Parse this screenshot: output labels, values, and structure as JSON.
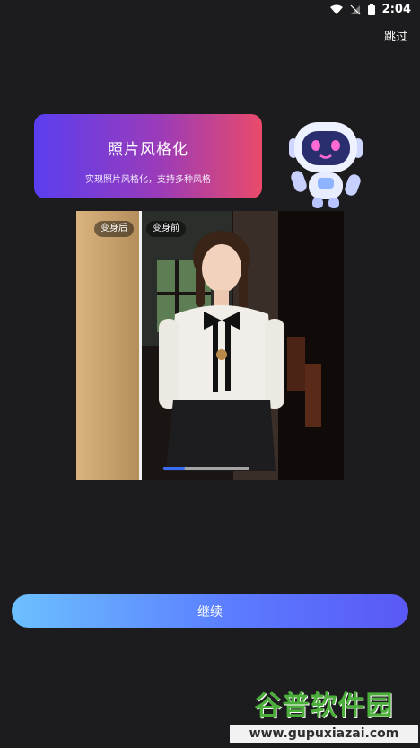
{
  "status_bar": {
    "time": "2:04"
  },
  "header": {
    "skip_label": "跳过"
  },
  "feature": {
    "title": "照片风格化",
    "subtitle": "实现照片风格化，支持多种风格"
  },
  "preview": {
    "after_label": "变身后",
    "before_label": "变身前",
    "progress": 0.25
  },
  "actions": {
    "continue_label": "继续"
  },
  "watermark": {
    "title": "谷普软件园",
    "url": "www.gupuxiazai.com"
  },
  "colors": {
    "background": "#1c1c1e",
    "card_gradient_start": "#5a3ef0",
    "card_gradient_end": "#e94a6a",
    "button_gradient_start": "#6cc0ff",
    "button_gradient_end": "#5a58f5",
    "progress": "#3b6df5"
  }
}
